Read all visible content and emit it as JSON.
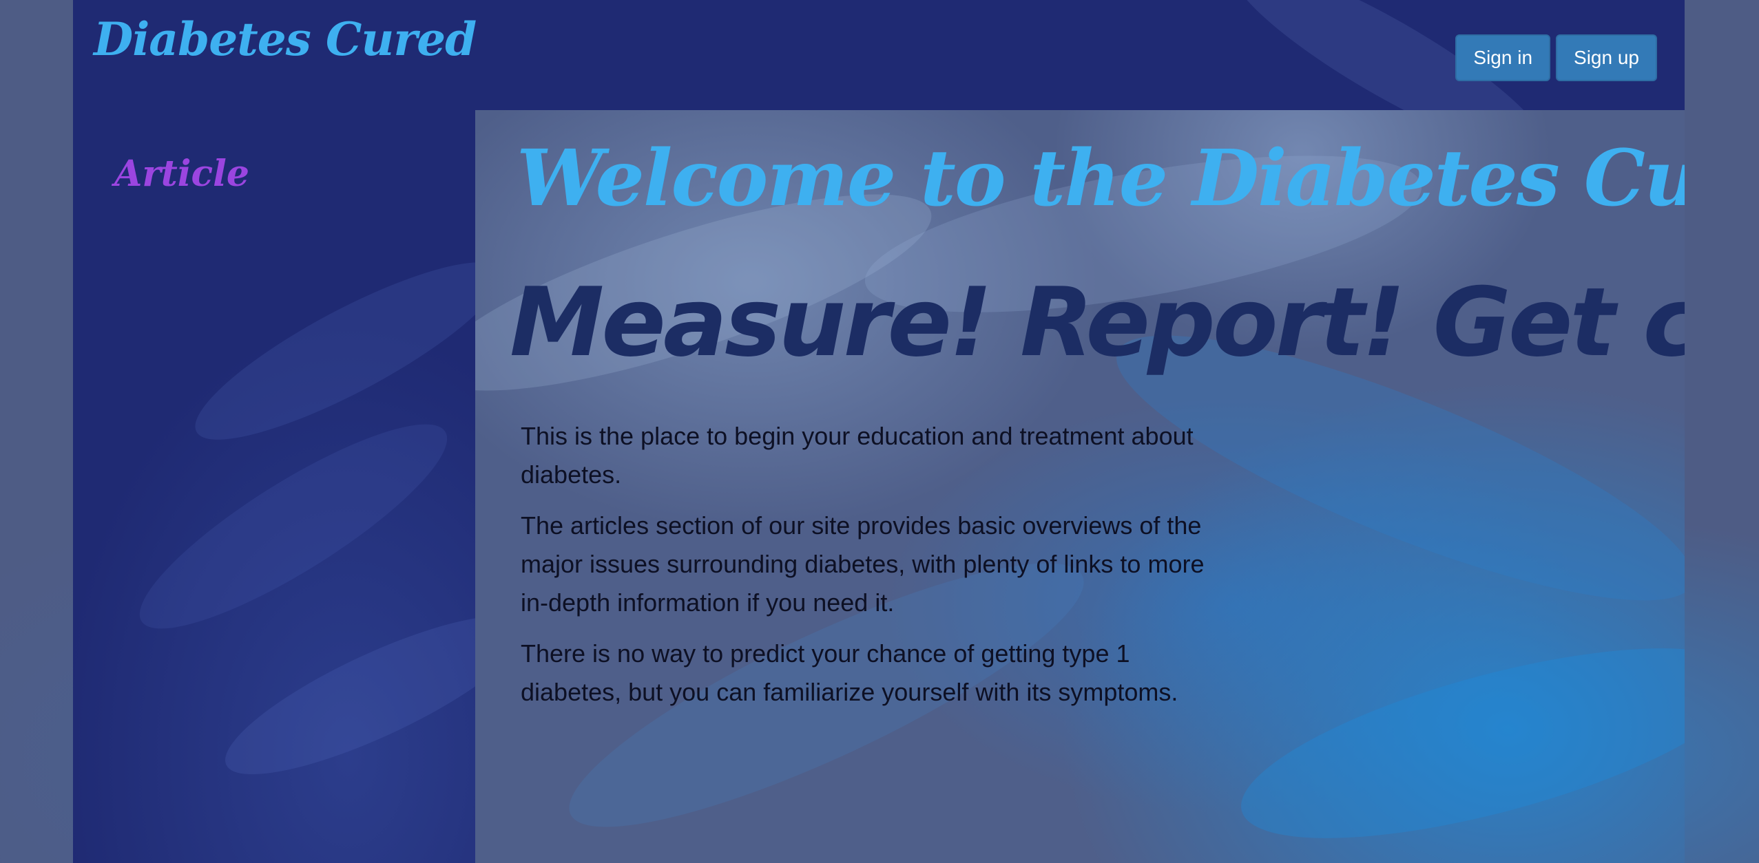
{
  "header": {
    "brand": "Diabetes Cured",
    "sign_in_label": "Sign in",
    "sign_up_label": "Sign up"
  },
  "sidebar": {
    "items": [
      {
        "label": "Article"
      }
    ]
  },
  "main": {
    "welcome_heading": "Welcome to the Diabetes Cured!",
    "tagline": "Measure! Report! Get cured!",
    "paragraphs": [
      "This is the place to begin your education and treatment about diabetes.",
      "The articles section of our site provides basic overviews of the major issues surrounding diabetes, with plenty of links to more in-depth information if you need it.",
      "There is no way to predict your chance of getting type 1 diabetes, but you can familiarize yourself with its symptoms."
    ]
  },
  "colors": {
    "page_background": "#4e5c85",
    "site_background": "#1f2a73",
    "brand_accent": "#3eb0f0",
    "sidebar_link": "#9b45e0",
    "tagline": "#1c2d64",
    "button": "#337ab7"
  }
}
